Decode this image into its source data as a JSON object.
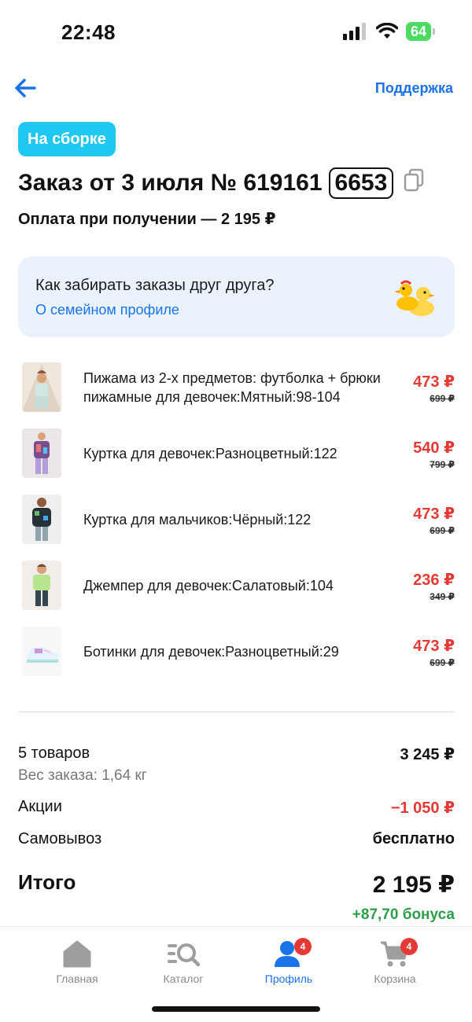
{
  "status_bar": {
    "time": "22:48",
    "battery": "64"
  },
  "nav": {
    "support": "Поддержка"
  },
  "order": {
    "status": "На сборке",
    "title": "Заказ от 3 июля № 619161",
    "code": "6653",
    "payment": "Оплата при получении — 2 195 ₽"
  },
  "family": {
    "question": "Как забирать заказы друг друга?",
    "link": "О семейном профиле"
  },
  "items": [
    {
      "name": "Пижама из 2-х предметов: футболка + брюки пижамные для девочек:Мятный:98-104",
      "price": "473 ₽",
      "old_price": "699 ₽"
    },
    {
      "name": "Куртка для девочек:Разноцветный:122",
      "price": "540 ₽",
      "old_price": "799 ₽"
    },
    {
      "name": "Куртка для мальчиков:Чёрный:122",
      "price": "473 ₽",
      "old_price": "699 ₽"
    },
    {
      "name": "Джемпер для девочек:Салатовый:104",
      "price": "236 ₽",
      "old_price": "349 ₽"
    },
    {
      "name": "Ботинки для девочек:Разноцветный:29",
      "price": "473 ₽",
      "old_price": "699 ₽"
    }
  ],
  "summary": {
    "count_label": "5 товаров",
    "count_value": "3 245 ₽",
    "weight": "Вес заказа: 1,64 кг",
    "promo_label": "Акции",
    "promo_value": "−1 050 ₽",
    "pickup_label": "Самовывоз",
    "pickup_value": "бесплатно",
    "total_label": "Итого",
    "total_value": "2 195 ₽",
    "bonus": "+87,70 бонуса"
  },
  "tabs": [
    {
      "label": "Главная",
      "icon": "home-icon"
    },
    {
      "label": "Каталог",
      "icon": "catalog-search-icon"
    },
    {
      "label": "Профиль",
      "icon": "profile-icon",
      "badge": "4",
      "active": true
    },
    {
      "label": "Корзина",
      "icon": "cart-icon",
      "badge": "4"
    }
  ],
  "colors": {
    "accent": "#1a73e8",
    "chip": "#1ec8f0",
    "price": "#e53935",
    "bonus": "#2e9e4b"
  }
}
